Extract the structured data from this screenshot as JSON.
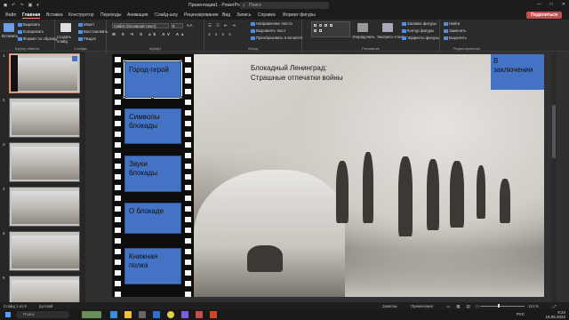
{
  "titlebar": {
    "qat": [
      "◼",
      "↶",
      "↷",
      "▣",
      "▾"
    ],
    "title": "Презентация1 - PowerPoint",
    "search_placeholder": "Поиск",
    "controls": [
      "—",
      "□",
      "✕"
    ]
  },
  "tabs": {
    "items": [
      "Файл",
      "Главная",
      "Вставка",
      "Конструктор",
      "Переходы",
      "Анимация",
      "Слайд-шоу",
      "Рецензирование",
      "Вид",
      "Запись",
      "Справка",
      "Формат фигуры"
    ],
    "active": "Главная",
    "share": "Поделиться"
  },
  "ribbon": {
    "clipboard": {
      "paste": "Вставить",
      "cut": "Вырезать",
      "copy": "Копировать",
      "format": "Формат по образцу",
      "label": "Буфер обмена"
    },
    "slides": {
      "new": "Создать слайд",
      "layout": "Макет",
      "reset": "Восстановить",
      "section": "Раздел",
      "label": "Слайды"
    },
    "font": {
      "name": "Calibri (Основной текст)",
      "size": "8",
      "label": "Шрифт"
    },
    "paragraph": {
      "direction": "Направление текста",
      "align": "Выровнять текст",
      "smartart": "Преобразовать в SmartArt",
      "label": "Абзац"
    },
    "drawing": {
      "arrange": "Упорядочить",
      "styles": "Экспресс-стили",
      "label": "Рисование"
    },
    "shape": {
      "fill": "Заливка фигуры",
      "outline": "Контур фигуры",
      "effects": "Эффекты фигуры"
    },
    "editing": {
      "find": "Найти",
      "replace": "Заменить",
      "select": "Выделить",
      "label": "Редактирование"
    }
  },
  "thumbnails": {
    "numbers": [
      "1",
      "2",
      "3",
      "4",
      "5",
      "6"
    ]
  },
  "slide": {
    "title_line1": "Блокадный Ленинград:",
    "title_line2": "Страшные отпечатки войны",
    "frames": [
      {
        "line1": "Город-герой",
        "line2": ""
      },
      {
        "line1": "Символы",
        "line2": "блокады"
      },
      {
        "line1": "Звуки",
        "line2": "блокады"
      },
      {
        "line1": "О блокаде",
        "line2": ""
      },
      {
        "line1": "Книжная",
        "line2": "полка"
      }
    ],
    "conclusion_line1": "В",
    "conclusion_line2": "заключении"
  },
  "status": {
    "slide": "Слайд 1 из 9",
    "lang": "русский",
    "notes": "Заметки",
    "comments": "Примечания",
    "zoom": "114 %"
  },
  "taskbar": {
    "search": "Поиск",
    "time": "9:24",
    "date": "15.05.2023",
    "lang": "РУС"
  },
  "colors": {
    "accent": "#4472c4",
    "share": "#c0504d"
  }
}
